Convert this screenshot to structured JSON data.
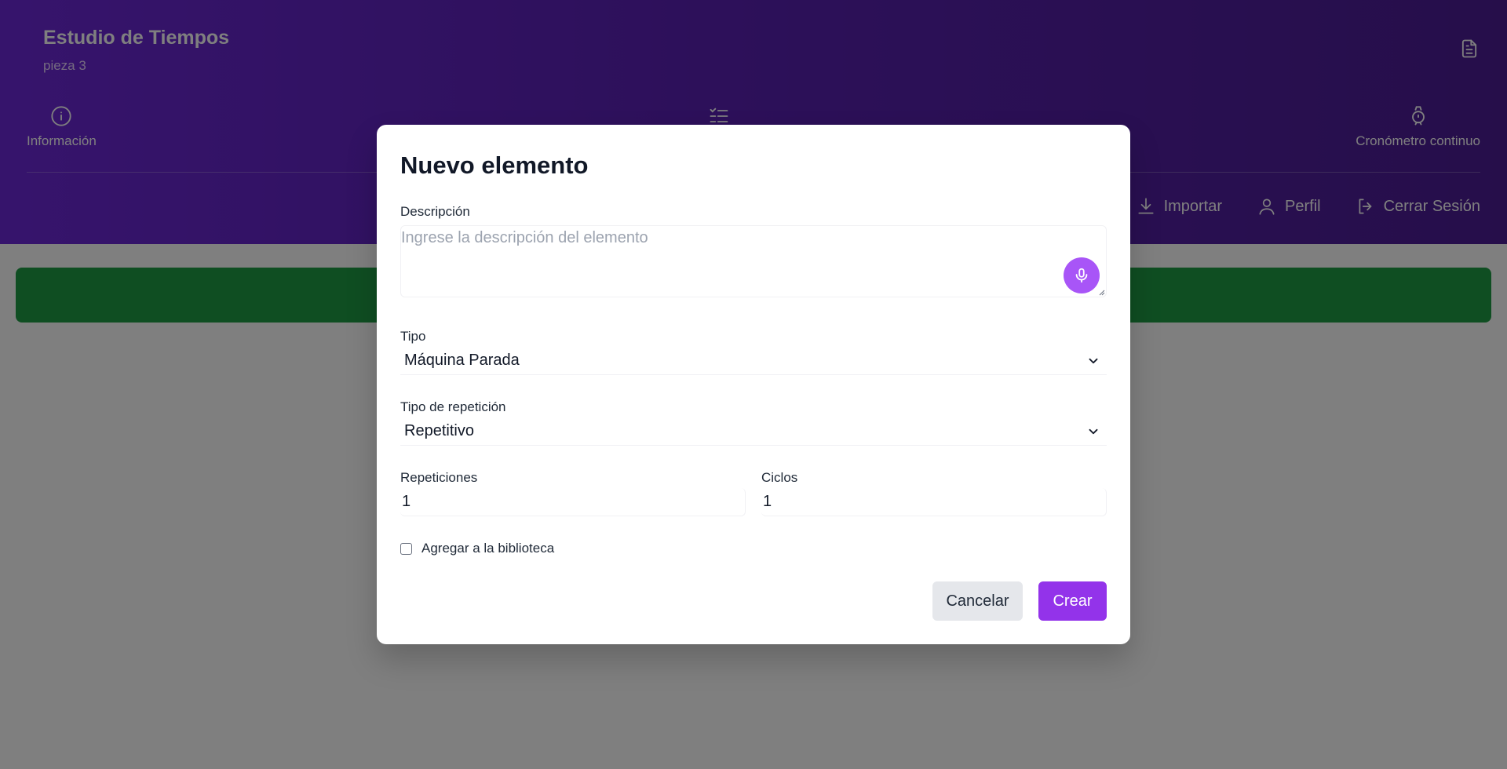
{
  "app": {
    "title": "Estudio de Tiempos",
    "subtitle": "pieza 3"
  },
  "tabs": [
    {
      "label": "Información",
      "icon": "info-icon"
    },
    {
      "label": "",
      "icon": "checklist-icon"
    },
    {
      "label": "Cronómetro continuo",
      "icon": "stopwatch-icon"
    }
  ],
  "actions": [
    {
      "label": "Importar",
      "icon": "import-icon"
    },
    {
      "label": "Perfil",
      "icon": "user-icon"
    },
    {
      "label": "Cerrar Sesión",
      "icon": "logout-icon"
    }
  ],
  "modal": {
    "title": "Nuevo elemento",
    "description": {
      "label": "Descripción",
      "placeholder": "Ingrese la descripción del elemento",
      "value": ""
    },
    "tipo": {
      "label": "Tipo",
      "selected": "Máquina Parada"
    },
    "tipo_repeticion": {
      "label": "Tipo de repetición",
      "selected": "Repetitivo"
    },
    "repeticiones": {
      "label": "Repeticiones",
      "value": "1"
    },
    "ciclos": {
      "label": "Ciclos",
      "value": "1"
    },
    "biblioteca": {
      "label": "Agregar a la biblioteca",
      "checked": false
    },
    "buttons": {
      "cancel": "Cancelar",
      "create": "Crear"
    }
  },
  "colors": {
    "header_start": "#6d28d9",
    "header_end": "#4c1d95",
    "green_bar": "#1f9d45",
    "primary": "#9333ea",
    "mic": "#a855f7"
  }
}
